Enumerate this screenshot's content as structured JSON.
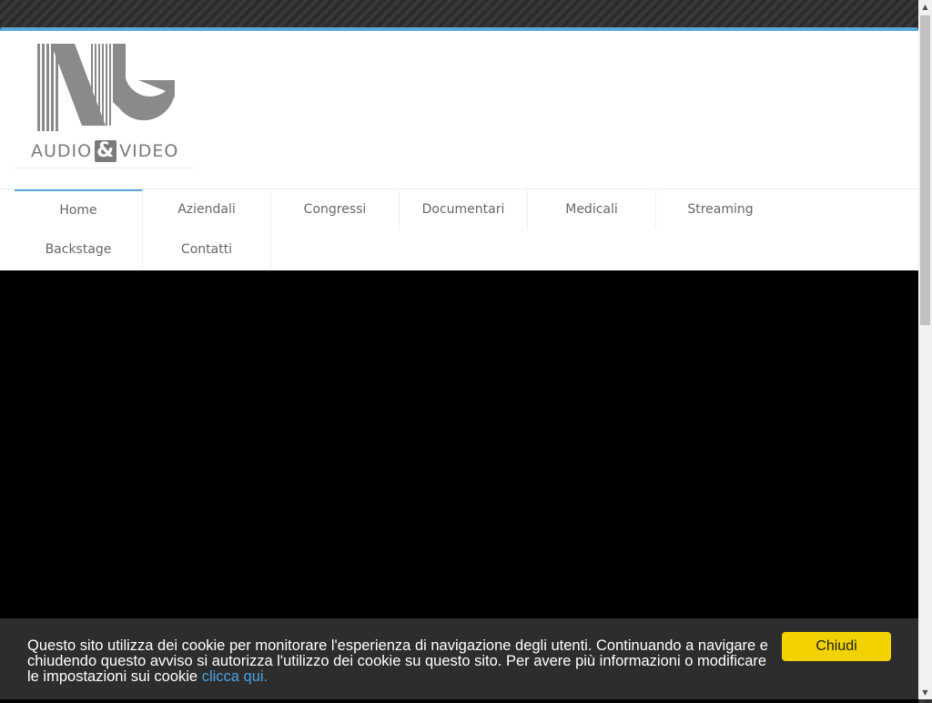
{
  "logo": {
    "text_left": "AUDIO",
    "ampersand": "&",
    "text_right": "VIDEO"
  },
  "nav": {
    "items": [
      {
        "label": "Home",
        "active": true
      },
      {
        "label": "Aziendali"
      },
      {
        "label": "Congressi"
      },
      {
        "label": "Documentari"
      },
      {
        "label": "Medicali"
      },
      {
        "label": "Streaming"
      },
      {
        "label": "Backstage"
      },
      {
        "label": "Contatti"
      }
    ]
  },
  "cookie": {
    "message": "Questo sito utilizza dei cookie per monitorare l'esperienza di navigazione degli utenti. Continuando a navigare e chiudendo questo avviso si autorizza l'utilizzo dei cookie su questo sito. Per avere più informazioni o modificare le impostazioni sui cookie ",
    "link_label": "clicca qui.",
    "close_label": "Chiudi"
  },
  "colors": {
    "accent": "#5aa9d6",
    "cookie_button": "#f2d200",
    "cookie_link": "#4aa3df"
  }
}
